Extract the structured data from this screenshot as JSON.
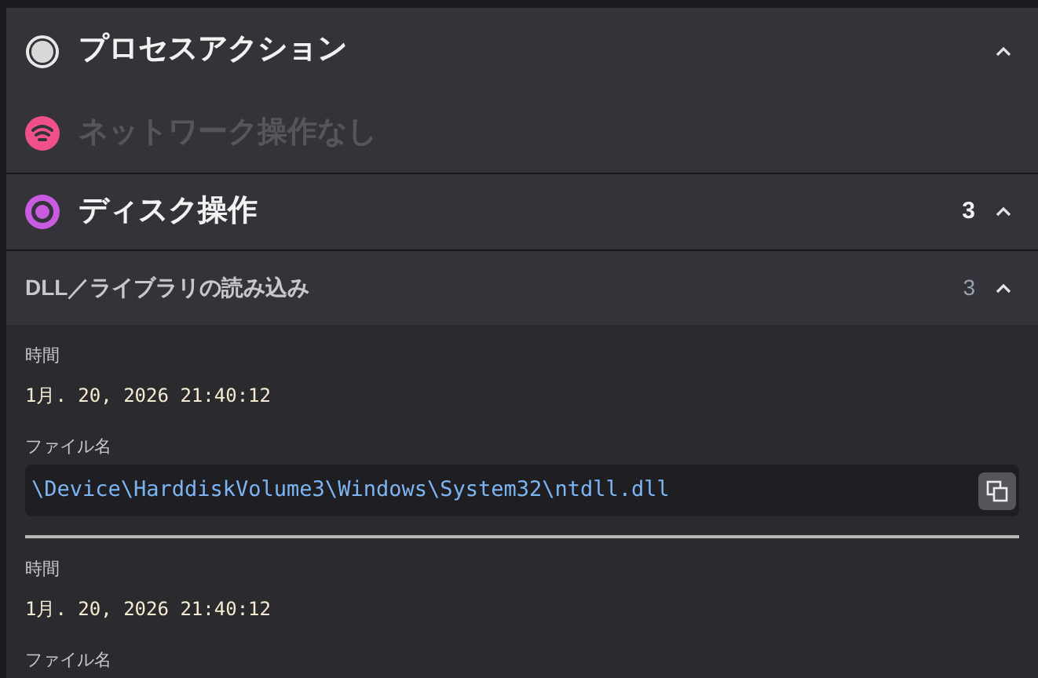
{
  "sections": [
    {
      "kind": "process",
      "title": "プロセスアクション",
      "expanded": true,
      "disabled": false
    },
    {
      "kind": "network",
      "title": "ネットワーク操作なし",
      "disabled": true
    },
    {
      "kind": "disk",
      "title": "ディスク操作",
      "count": "3",
      "expanded": true,
      "disabled": false
    }
  ],
  "subsection": {
    "title": "DLL／ライブラリの読み込み",
    "count": "3",
    "expanded": true,
    "entries": [
      {
        "time_label": "時間",
        "time": "1月. 20, 2026 21:40:12",
        "file_label": "ファイル名",
        "path": "\\Device\\HarddiskVolume3\\Windows\\System32\\ntdll.dll"
      },
      {
        "time_label": "時間",
        "time": "1月. 20, 2026 21:40:12",
        "file_label": "ファイル名"
      }
    ]
  }
}
